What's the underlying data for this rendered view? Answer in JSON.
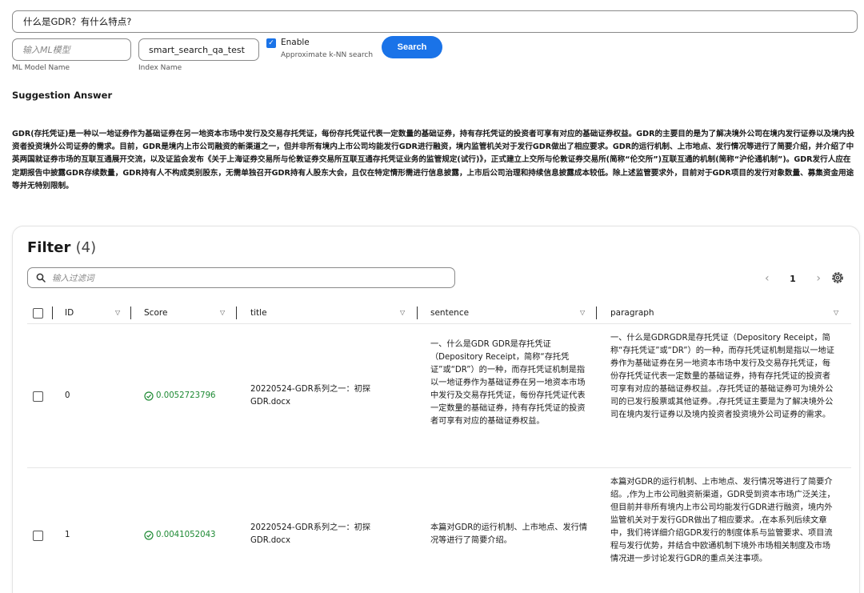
{
  "query": {
    "value": "什么是GDR？有什么特点?"
  },
  "model_field": {
    "placeholder": "输入ML模型",
    "label": "ML Model Name"
  },
  "index_field": {
    "value": "smart_search_qa_test",
    "label": "Index Name"
  },
  "knn": {
    "enabled": true,
    "label": "Enable",
    "sublabel": "Approximate k-NN search"
  },
  "search_button": {
    "label": "Search"
  },
  "suggestion": {
    "title": "Suggestion Answer",
    "text": "GDR(存托凭证)是一种以一地证券作为基础证券在另一地资本市场中发行及交易存托凭证，每份存托凭证代表一定数量的基础证券，持有存托凭证的投资者可享有对应的基础证券权益。GDR的主要目的是为了解决境外公司在境内发行证券以及境内投资者投资境外公司证券的需求。目前，GDR是境内上市公司融资的新渠道之一，但并非所有境内上市公司均能发行GDR进行融资，境内监管机关对于发行GDR做出了相应要求。GDR的运行机制、上市地点、发行情况等进行了简要介绍，并介绍了中英两国就证券市场的互联互通展开交流，以及证监会发布《关于上海证券交易所与伦敦证券交易所互联互通存托凭证业务的监管规定(试行)》，正式建立上交所与伦敦证券交易所(简称“伦交所”)互联互通的机制(简称“沪伦通机制”)。GDR发行人应在定期报告中披露GDR存续数量，GDR持有人不构成类别股东，无需单独召开GDR持有人股东大会，且仅在特定情形需进行信息披露，上市后公司治理和持续信息披露成本较低。除上述监管要求外，目前对于GDR项目的发行对象数量、募集资金用途等并无特别限制。"
  },
  "filter": {
    "title": "Filter",
    "count": "(4)",
    "placeholder": "输入过滤词",
    "page": "1",
    "columns": {
      "id": "ID",
      "score": "Score",
      "title": "title",
      "sentence": "sentence",
      "paragraph": "paragraph"
    },
    "rows": [
      {
        "id": "0",
        "score": "0.0052723796",
        "title": "20220524-GDR系列之一：初探GDR.docx",
        "sentence": "一、什么是GDR GDR是存托凭证（Depository Receipt，简称“存托凭证”或“DR”）的一种，而存托凭证机制是指以一地证券作为基础证券在另一地资本市场中发行及交易存托凭证，每份存托凭证代表一定数量的基础证券，持有存托凭证的投资者可享有对应的基础证券权益。",
        "paragraph": "一、什么是GDRGDR是存托凭证（Depository Receipt，简称“存托凭证”或“DR”）的一种，而存托凭证机制是指以一地证券作为基础证券在另一地资本市场中发行及交易存托凭证，每份存托凭证代表一定数量的基础证券，持有存托凭证的投资者可享有对应的基础证券权益。,存托凭证的基础证券可为境外公司的已发行股票或其他证券。,存托凭证主要是为了解决境外公司在境内发行证券以及境内投资者投资境外公司证券的需求。"
      },
      {
        "id": "1",
        "score": "0.0041052043",
        "title": "20220524-GDR系列之一：初探GDR.docx",
        "sentence": "本篇对GDR的运行机制、上市地点、发行情况等进行了简要介绍。",
        "paragraph": "本篇对GDR的运行机制、上市地点、发行情况等进行了简要介绍。,作为上市公司融资新渠道，GDR受到资本市场广泛关注，但目前并非所有境内上市公司均能发行GDR进行融资，境内外监管机关对于发行GDR做出了相应要求。,在本系列后续文章中，我们将详细介绍GDR发行的制度体系与监管要求、项目流程与发行优势，并结合中欧通机制下境外市场相关制度及市场情况进一步讨论发行GDR的重点关注事项。"
      }
    ]
  },
  "icons": {
    "search": "search-icon",
    "settings": "gear-icon",
    "check": "check-circle-icon",
    "sort": "sort-down-icon"
  },
  "colors": {
    "accent": "#1a73e8",
    "score": "#1e8a34"
  }
}
